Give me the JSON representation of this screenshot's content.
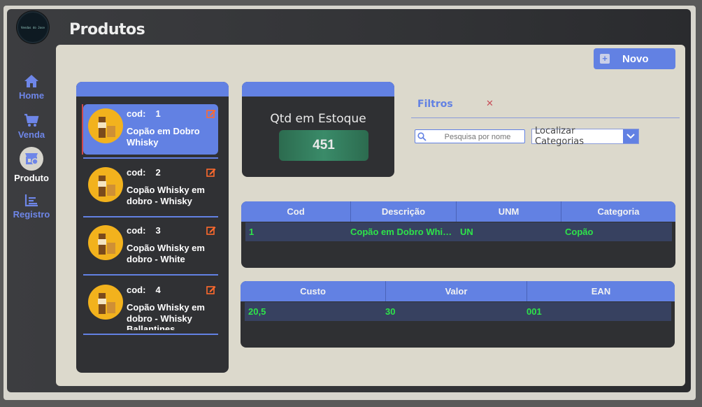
{
  "app": {
    "logo_text": "Vendas do Jose",
    "page_title": "Produtos"
  },
  "sidebar": {
    "items": [
      {
        "label": "Home",
        "icon": "home-icon"
      },
      {
        "label": "Venda",
        "icon": "cart-icon"
      },
      {
        "label": "Produto",
        "icon": "product-icon",
        "active": true
      },
      {
        "label": "Registro",
        "icon": "chart-icon"
      }
    ]
  },
  "toolbar": {
    "new_label": "Novo"
  },
  "products": [
    {
      "cod_label": "cod:",
      "cod": "1",
      "name": "Copão em Dobro Whisky"
    },
    {
      "cod_label": "cod:",
      "cod": "2",
      "name": "Copão Whisky em dobro - Whisky Bell's"
    },
    {
      "cod_label": "cod:",
      "cod": "3",
      "name": "Copão Whisky em dobro - White Horse"
    },
    {
      "cod_label": "cod:",
      "cod": "4",
      "name": "Copão Whisky em dobro - Whisky Ballantines"
    }
  ],
  "stock": {
    "label": "Qtd em Estoque",
    "value": "451"
  },
  "filters": {
    "title": "Filtros",
    "clear": "✕",
    "search_placeholder": "Pesquisa por nome",
    "category_placeholder": "Localizar Categorias"
  },
  "table1": {
    "headers": [
      "Cod",
      "Descrição",
      "UNM",
      "Categoria"
    ],
    "row": [
      "1",
      "Copão em Dobro Whisky",
      "UN",
      "Copão"
    ]
  },
  "table2": {
    "headers": [
      "Custo",
      "Valor",
      "EAN"
    ],
    "row": [
      "20,5",
      "30",
      "001"
    ]
  },
  "colors": {
    "accent": "#6281e3",
    "text_green": "#2ee34a",
    "stock_green": "#2c6b4f",
    "edit_orange": "#ff6a2e",
    "active_marker": "#d0474b"
  }
}
